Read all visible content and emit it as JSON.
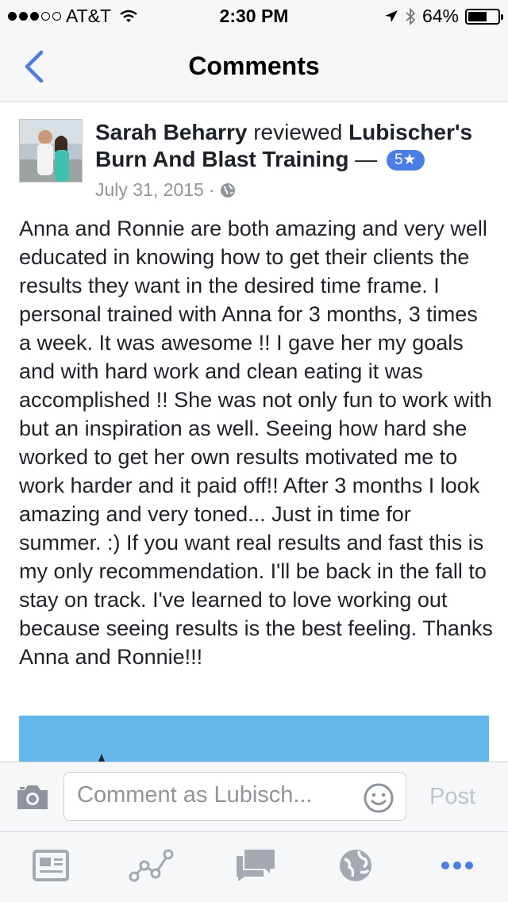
{
  "status_bar": {
    "carrier": "AT&T",
    "time": "2:30 PM",
    "battery": "64%",
    "battery_level": 0.64
  },
  "nav": {
    "title": "Comments",
    "back_icon": "chevron-left-icon"
  },
  "post": {
    "author": "Sarah Beharry",
    "action": "reviewed",
    "page_name": "Lubischer's Burn And Blast Training",
    "separator": "—",
    "rating": "5★",
    "date": "July 31, 2015",
    "date_separator": "·",
    "privacy_icon": "globe-icon",
    "text": "Anna and Ronnie are both amazing and very well educated in knowing how to get their clients the results they want in the desired time frame. I personal trained with Anna for 3 months, 3 times a week. It was awesome !! I gave her my goals and with hard work and clean eating it was accomplished !! She was not only fun to work with but an inspiration as well. Seeing how hard she worked to get her own results motivated me to work harder and it paid off!! After 3 months I look amazing and very toned... Just in time for summer. :)  If you want real results and fast this is my only recommendation. I'll be back in the fall to stay on track. I've learned to love working out because seeing results is the best feeling. Thanks Anna and Ronnie!!!"
  },
  "comment_bar": {
    "placeholder": "Comment as Lubisch...",
    "post_label": "Post"
  },
  "tabs": [
    "news-feed-icon",
    "insights-icon",
    "messages-icon",
    "globe-icon",
    "more-icon"
  ],
  "colors": {
    "accent": "#4a7ee6",
    "bar_bg": "#f6f7f9",
    "muted": "#90949c",
    "icon_gray": "#a4a9b1"
  }
}
